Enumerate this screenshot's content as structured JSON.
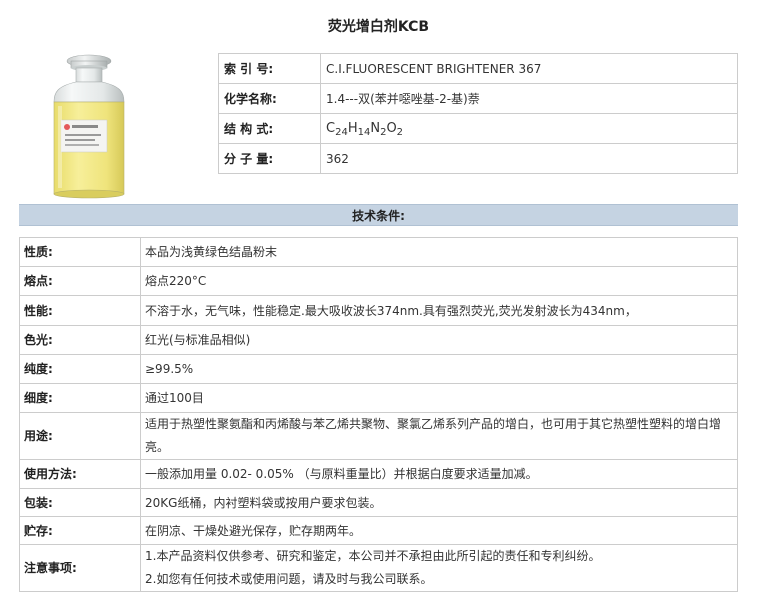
{
  "page": {
    "title": "荧光增白剂KCB"
  },
  "product_image": {
    "icon": "reagent-bottle-yellow-powder",
    "color": "#f2e88a",
    "label_lines": [
      "荧光增白剂 KCB",
      "C.I.FLUORESCENT",
      "净含量"
    ]
  },
  "basic_info": [
    {
      "label": "索 引 号:",
      "value": "C.I.FLUORESCENT BRIGHTENER 367"
    },
    {
      "label": "化学名称:",
      "value": "1.4---双(苯并噁唑基-2-基)萘"
    },
    {
      "label": "结 构 式:",
      "value": "C24H14N2O2",
      "formula_parts": [
        "C",
        "24",
        "H",
        "14",
        "N",
        "2",
        "O",
        "2"
      ]
    },
    {
      "label": "分 子 量:",
      "value": "362"
    }
  ],
  "section_title": "技术条件:",
  "specs": [
    {
      "label": "性质:",
      "value": "本品为浅黄绿色结晶粉末"
    },
    {
      "label": "熔点:",
      "value": "熔点220°C"
    },
    {
      "label": "性能:",
      "value": "不溶于水，无气味，性能稳定.最大吸收波长374nm.具有强烈荧光,荧光发射波长为434nm，"
    },
    {
      "label": "色光:",
      "value": "红光(与标准品相似)"
    },
    {
      "label": "纯度:",
      "value": "≥99.5%"
    },
    {
      "label": "细度:",
      "value": "通过100目"
    },
    {
      "label": "用途:",
      "value": "适用于热塑性聚氨酯和丙烯酸与苯乙烯共聚物、聚氯乙烯系列产品的增白，也可用于其它热塑性塑料的增白增亮。"
    },
    {
      "label": "使用方法:",
      "value": "一般添加用量 0.02- 0.05% （与原料重量比）并根据白度要求适量加减。"
    },
    {
      "label": "包装:",
      "value": "20KG纸桶，内衬塑料袋或按用户要求包装。"
    },
    {
      "label": "贮存:",
      "value": "在阴凉、干燥处避光保存，贮存期两年。"
    },
    {
      "label": "注意事项:",
      "lines": [
        "1.本产品资料仅供参考、研究和鉴定，本公司并不承担由此所引起的责任和专利纠纷。",
        "2.如您有任何技术或使用问题，请及时与我公司联系。"
      ]
    }
  ]
}
